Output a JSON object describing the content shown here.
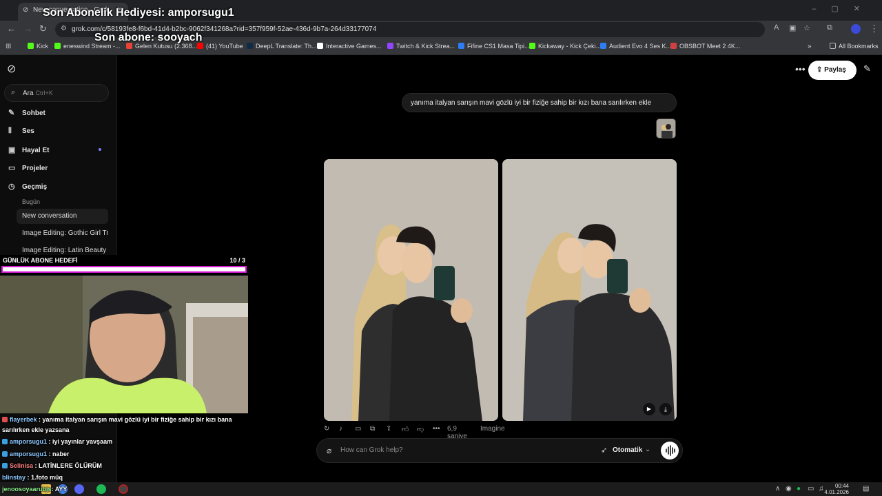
{
  "browser": {
    "tab_title": "New conversation - Grok",
    "tab_close": "✕",
    "new_tab": "+",
    "url": "grok.com/c/58193fe8-f6bd-41d4-b2bc-9062f341268a?rid=357f959f-52ae-436d-9b7a-264d33177074",
    "bookmarks": [
      "Kick",
      "eneswind Stream -...",
      "Gelen Kutusu (2.368...",
      "(41) YouTube",
      "DeepL Translate: Th...",
      "Interactive Games...",
      "Twitch & Kick Strea...",
      "Fifine CS1 Masa Tipi...",
      "Kickaway - Kick Çeki...",
      "Audient Evo 4 Ses K...",
      "OBSBOT Meet 2 4K..."
    ],
    "all_bookmarks": "All Bookmarks"
  },
  "overlay": {
    "last_sub_gift": "Son Abonelik Hediyesi: amporsugu1",
    "last_sub": "Son abone: sooyach",
    "goal_label": "GÜNLÜK ABONE HEDEFİ",
    "goal_count": "10 / 3"
  },
  "sidebar": {
    "search_label": "Ara",
    "search_hint": "Ctrl+K",
    "items": [
      {
        "label": "Sohbet",
        "icon": "chat-icon"
      },
      {
        "label": "Ses",
        "icon": "voice-icon"
      },
      {
        "label": "Hayal Et",
        "icon": "imagine-icon"
      },
      {
        "label": "Projeler",
        "icon": "folder-icon"
      },
      {
        "label": "Geçmiş",
        "icon": "history-icon"
      }
    ],
    "today": "Bugün",
    "history": [
      "New conversation",
      "Image Editing: Gothic Girl Tr",
      "Image Editing: Latin Beauty"
    ]
  },
  "chat_overlay": [
    {
      "user": "flayerbek",
      "text": "yanıma italyan sarışın mavi gözlü iyi bir fiziğe sahip bir kızı bana",
      "badge": "#e05050"
    },
    {
      "user": "",
      "text": "sarılırken ekle yazsana",
      "badge": ""
    },
    {
      "user": "amporsugu1",
      "text": "iyi yayınlar yavşaam",
      "badge": "#3aa0e0"
    },
    {
      "user": "amporsugu1",
      "text": "naber",
      "badge": "#3aa0e0"
    },
    {
      "user": "Selinisa",
      "text": "LATİNLERE ÖLÜRÜM",
      "badge": "#3aa0e0"
    },
    {
      "user": "blinstay",
      "text": "1.foto müq",
      "badge": ""
    },
    {
      "user": "jenoosoyaarubjs",
      "text": "AYY",
      "badge": ""
    }
  ],
  "main": {
    "share_label": "Paylaş",
    "user_message": "yanıma italyan sarışın mavi gözlü iyi bir fiziğe sahip bir kızı bana sarılırken ekle",
    "duration": "6,9 saniye",
    "model": "Imagine",
    "composer_placeholder": "How can Grok help?",
    "mode_label": "Otomatik"
  },
  "taskbar": {
    "time": "00:44",
    "date": "4.01.2026"
  }
}
